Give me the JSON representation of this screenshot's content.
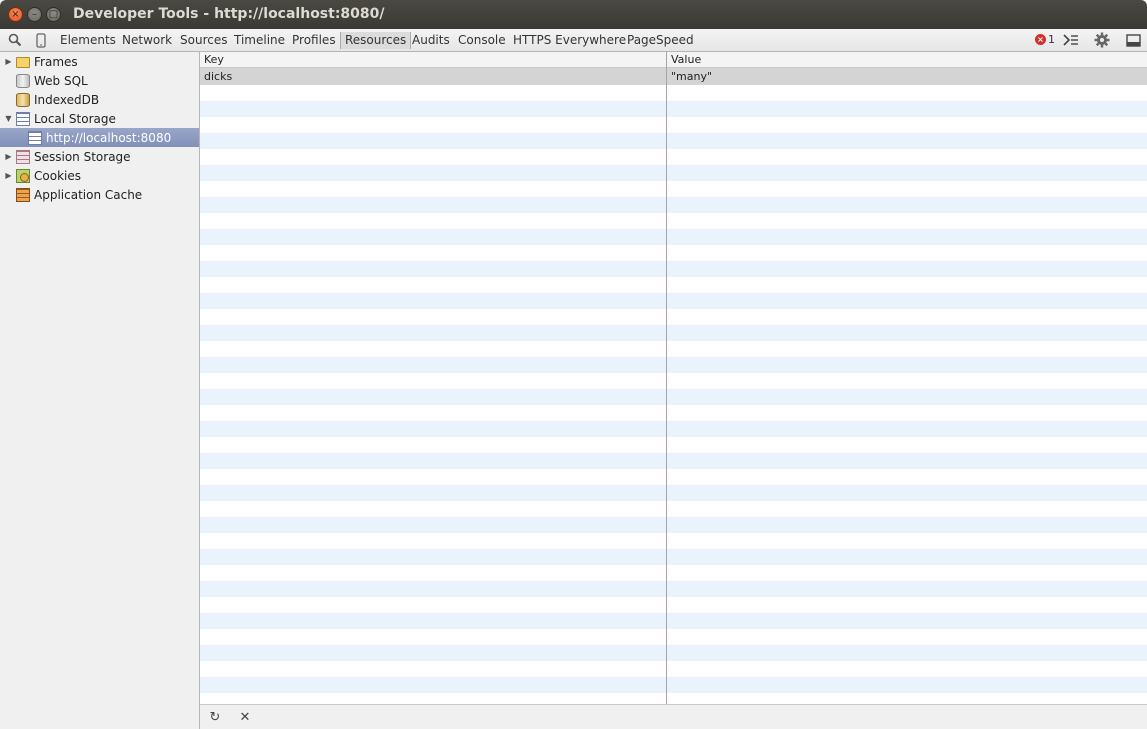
{
  "window": {
    "title": "Developer Tools - http://localhost:8080/",
    "close_glyph": "×",
    "min_glyph": "–",
    "max_glyph": "□"
  },
  "toolbar": {
    "tabs": [
      "Elements",
      "Network",
      "Sources",
      "Timeline",
      "Profiles",
      "Resources",
      "Audits",
      "Console",
      "HTTPS Everywhere",
      "PageSpeed"
    ],
    "selected_tab": "Resources",
    "error_count": "1",
    "icons": [
      "search-icon",
      "device-mode-icon",
      "console-drawer-icon",
      "gear-icon",
      "dock-icon"
    ]
  },
  "sidebar": {
    "items": [
      {
        "label": "Frames",
        "icon": "folder-icon",
        "disclosure": "▶"
      },
      {
        "label": "Web SQL",
        "icon": "database-icon",
        "disclosure": ""
      },
      {
        "label": "IndexedDB",
        "icon": "database-icon",
        "disclosure": ""
      },
      {
        "label": "Local Storage",
        "icon": "storage-grid-icon",
        "disclosure": "▼"
      },
      {
        "label": "http://localhost:8080",
        "icon": "storage-grid-icon",
        "disclosure": ""
      },
      {
        "label": "Session Storage",
        "icon": "storage-grid-icon",
        "disclosure": "▶"
      },
      {
        "label": "Cookies",
        "icon": "cookie-icon",
        "disclosure": "▶"
      },
      {
        "label": "Application Cache",
        "icon": "app-cache-icon",
        "disclosure": ""
      }
    ],
    "selected": "http://localhost:8080"
  },
  "storage_table": {
    "columns": [
      "Key",
      "Value"
    ],
    "rows": [
      {
        "key": "dicks",
        "value": "\"many\""
      }
    ]
  },
  "statusbar": {
    "refresh_glyph": "↻",
    "delete_glyph": "✕"
  },
  "colors": {
    "selection": "#8190b8",
    "row_stripe": "#eaf3fd",
    "error": "#d2322d"
  }
}
